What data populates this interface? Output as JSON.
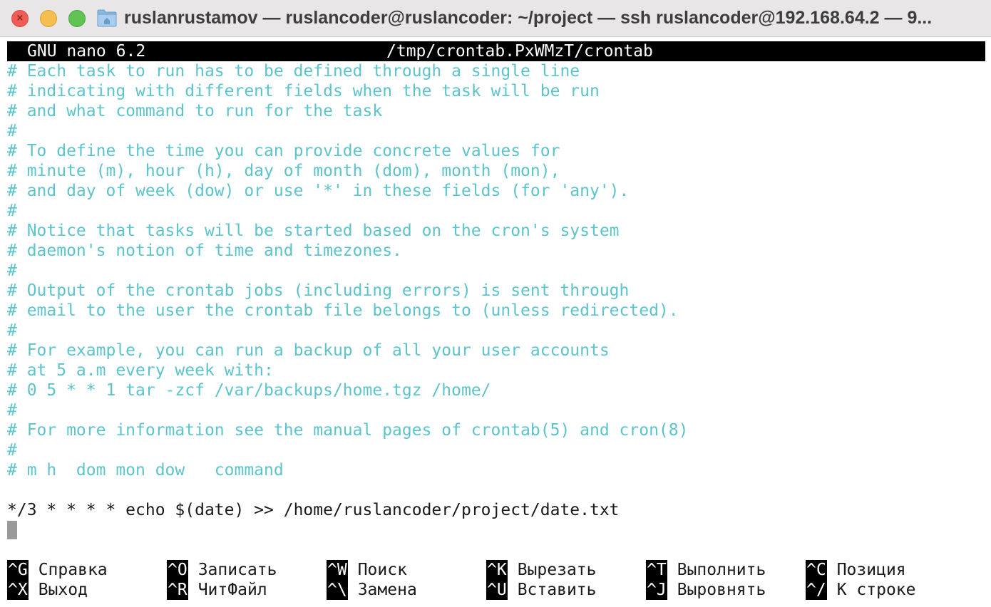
{
  "window": {
    "title": "ruslanrustamov — ruslancoder@ruslancoder: ~/project — ssh ruslancoder@192.168.64.2 — 9..."
  },
  "nano": {
    "version": "GNU nano 6.2",
    "filename": "/tmp/crontab.PxWMzT/crontab"
  },
  "file": {
    "comment_lines": [
      "# Each task to run has to be defined through a single line",
      "# indicating with different fields when the task will be run",
      "# and what command to run for the task",
      "#",
      "# To define the time you can provide concrete values for",
      "# minute (m), hour (h), day of month (dom), month (mon),",
      "# and day of week (dow) or use '*' in these fields (for 'any').",
      "#",
      "# Notice that tasks will be started based on the cron's system",
      "# daemon's notion of time and timezones.",
      "#",
      "# Output of the crontab jobs (including errors) is sent through",
      "# email to the user the crontab file belongs to (unless redirected).",
      "#",
      "# For example, you can run a backup of all your user accounts",
      "# at 5 a.m every week with:",
      "# 0 5 * * 1 tar -zcf /var/backups/home.tgz /home/",
      "#",
      "# For more information see the manual pages of crontab(5) and cron(8)",
      "#",
      "# m h  dom mon dow   command"
    ],
    "cron_entry": "*/3 * * * * echo $(date) >> /home/ruslancoder/project/date.txt"
  },
  "shortcuts": [
    {
      "key": "^G",
      "label": "Справка"
    },
    {
      "key": "^O",
      "label": "Записать"
    },
    {
      "key": "^W",
      "label": "Поиск"
    },
    {
      "key": "^K",
      "label": "Вырезать"
    },
    {
      "key": "^T",
      "label": "Выполнить"
    },
    {
      "key": "^C",
      "label": "Позиция"
    },
    {
      "key": "^X",
      "label": "Выход"
    },
    {
      "key": "^R",
      "label": "ЧитФайл"
    },
    {
      "key": "^\\",
      "label": "Замена"
    },
    {
      "key": "^U",
      "label": "Вставить"
    },
    {
      "key": "^J",
      "label": "Выровнять"
    },
    {
      "key": "^/",
      "label": "К строке"
    }
  ],
  "colors": {
    "comment": "#5cc4cc",
    "text": "#1a1a1a",
    "bar_bg": "#000000",
    "bar_fg": "#ffffff"
  }
}
